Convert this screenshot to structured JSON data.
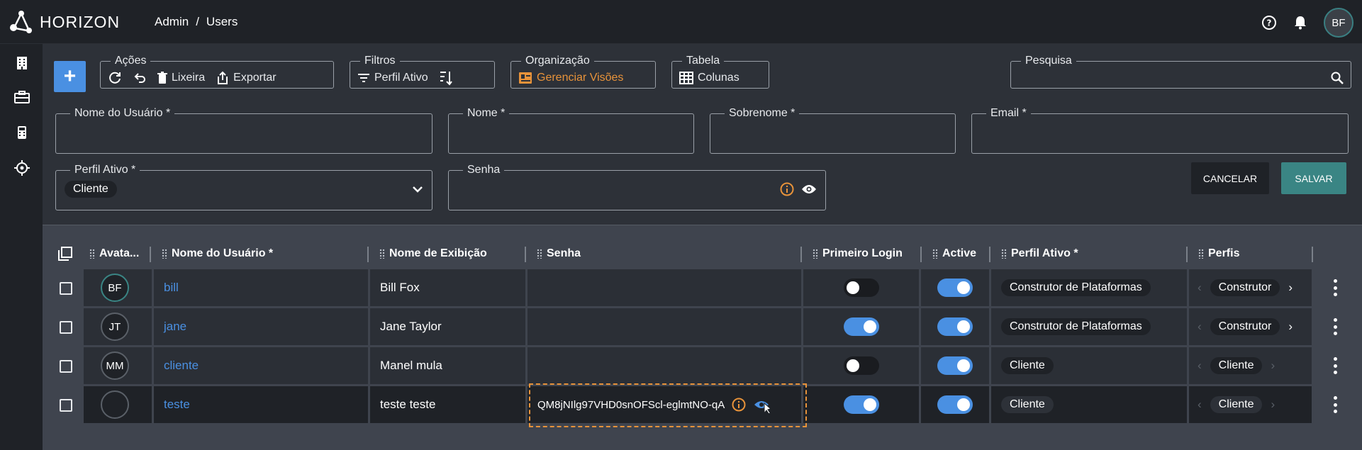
{
  "app": {
    "name": "HORIZON"
  },
  "breadcrumb": {
    "part1": "Admin",
    "sep": "/",
    "part2": "Users"
  },
  "user": {
    "initials": "BF"
  },
  "toolbar": {
    "acoes": {
      "legend": "Ações",
      "lixeira": "Lixeira",
      "exportar": "Exportar"
    },
    "filtros": {
      "legend": "Filtros",
      "perfil_ativo": "Perfil Ativo"
    },
    "organizacao": {
      "legend": "Organização",
      "gerenciar": "Gerenciar Visões"
    },
    "tabela": {
      "legend": "Tabela",
      "colunas": "Colunas"
    },
    "pesquisa": {
      "legend": "Pesquisa",
      "value": ""
    }
  },
  "form": {
    "nome_usuario": {
      "label": "Nome do Usuário *",
      "value": ""
    },
    "nome": {
      "label": "Nome *",
      "value": ""
    },
    "sobrenome": {
      "label": "Sobrenome *",
      "value": ""
    },
    "email": {
      "label": "Email *",
      "value": ""
    },
    "perfil_ativo": {
      "label": "Perfil Ativo *",
      "value": "Cliente"
    },
    "senha": {
      "label": "Senha",
      "value": ""
    },
    "cancel": "CANCELAR",
    "save": "SALVAR"
  },
  "grid": {
    "columns": {
      "avatar": "Avata...",
      "nome_usuario": "Nome do Usuário *",
      "nome_exibicao": "Nome de Exibição",
      "senha": "Senha",
      "primeiro_login": "Primeiro Login",
      "active": "Active",
      "perfil_ativo": "Perfil Ativo *",
      "perfis": "Perfis"
    },
    "rows": [
      {
        "initials": "BF",
        "username": "bill",
        "display": "Bill Fox",
        "password": "",
        "first_login": false,
        "active": true,
        "profile": "Construtor de Plataformas",
        "perfis": "Construtor"
      },
      {
        "initials": "JT",
        "username": "jane",
        "display": "Jane Taylor",
        "password": "",
        "first_login": true,
        "active": true,
        "profile": "Construtor de Plataformas",
        "perfis": "Construtor"
      },
      {
        "initials": "MM",
        "username": "cliente",
        "display": "Manel mula",
        "password": "",
        "first_login": false,
        "active": true,
        "profile": "Cliente",
        "perfis": "Cliente"
      },
      {
        "initials": "",
        "username": "teste",
        "display": "teste teste",
        "password": "QM8jNIlg97VHD0snOFScl-eglmtNO-qA",
        "first_login": true,
        "active": true,
        "profile": "Cliente",
        "perfis": "Cliente"
      }
    ]
  },
  "colors": {
    "accent": "#4a90e2",
    "orange": "#e8933a",
    "teal": "#3a8584"
  }
}
